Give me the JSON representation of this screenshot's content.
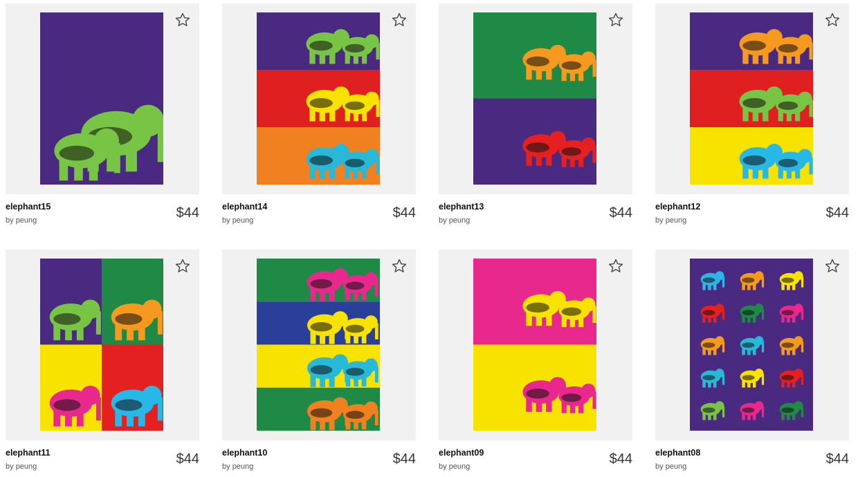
{
  "products": [
    {
      "title": "elephant15",
      "by": "by",
      "artist": "peung",
      "price": "$44",
      "bands": [
        "#4a2a80"
      ],
      "layout": "single",
      "elephant": "#78c444"
    },
    {
      "title": "elephant14",
      "by": "by",
      "artist": "peung",
      "price": "$44",
      "bands": [
        "#4a2a80",
        "#e02020",
        "#f08020"
      ],
      "layout": "rows",
      "elephant": [
        "#78c444",
        "#f7e200",
        "#28b8d8"
      ]
    },
    {
      "title": "elephant13",
      "by": "by",
      "artist": "peung",
      "price": "$44",
      "bands": [
        "#1f8a45",
        "#4a2a80"
      ],
      "layout": "rows",
      "elephant": [
        "#f59a1e",
        "#e52020"
      ]
    },
    {
      "title": "elephant12",
      "by": "by",
      "artist": "peung",
      "price": "$44",
      "bands": [
        "#4a2a80",
        "#e02020",
        "#f7e200"
      ],
      "layout": "rows",
      "elephant": [
        "#f59a1e",
        "#78c444",
        "#28b8e8"
      ]
    },
    {
      "title": "elephant11",
      "by": "by",
      "artist": "peung",
      "price": "$44",
      "bands": [
        "#4a2a80",
        "#1f8a45",
        "#f7e200",
        "#e52020"
      ],
      "layout": "quad",
      "elephant": [
        "#78c444",
        "#f59a1e",
        "#e8288c",
        "#28b8e8"
      ]
    },
    {
      "title": "elephant10",
      "by": "by",
      "artist": "peung",
      "price": "$44",
      "bands": [
        "#1f8a45",
        "#2a3f9a",
        "#f7e200",
        "#1f8a45"
      ],
      "layout": "rows",
      "elephant": [
        "#e8288c",
        "#f7e200",
        "#28b8d8",
        "#f08020"
      ]
    },
    {
      "title": "elephant09",
      "by": "by",
      "artist": "peung",
      "price": "$44",
      "bands": [
        "#e8288c",
        "#f7e200"
      ],
      "layout": "rows",
      "elephant": [
        "#f7e200",
        "#e8288c"
      ]
    },
    {
      "title": "elephant08",
      "by": "by",
      "artist": "peung",
      "price": "$44",
      "bands": [
        "#4a2a80"
      ],
      "layout": "pattern",
      "elephant": [
        "#28b8e8",
        "#f59a1e",
        "#f7e200",
        "#e52020",
        "#1f8a45",
        "#e8288c",
        "#f59a1e",
        "#28b8d8",
        "#f59a1e",
        "#28b8d8",
        "#f7e200",
        "#e52020",
        "#78c444",
        "#e8288c",
        "#1f8a45"
      ]
    }
  ]
}
